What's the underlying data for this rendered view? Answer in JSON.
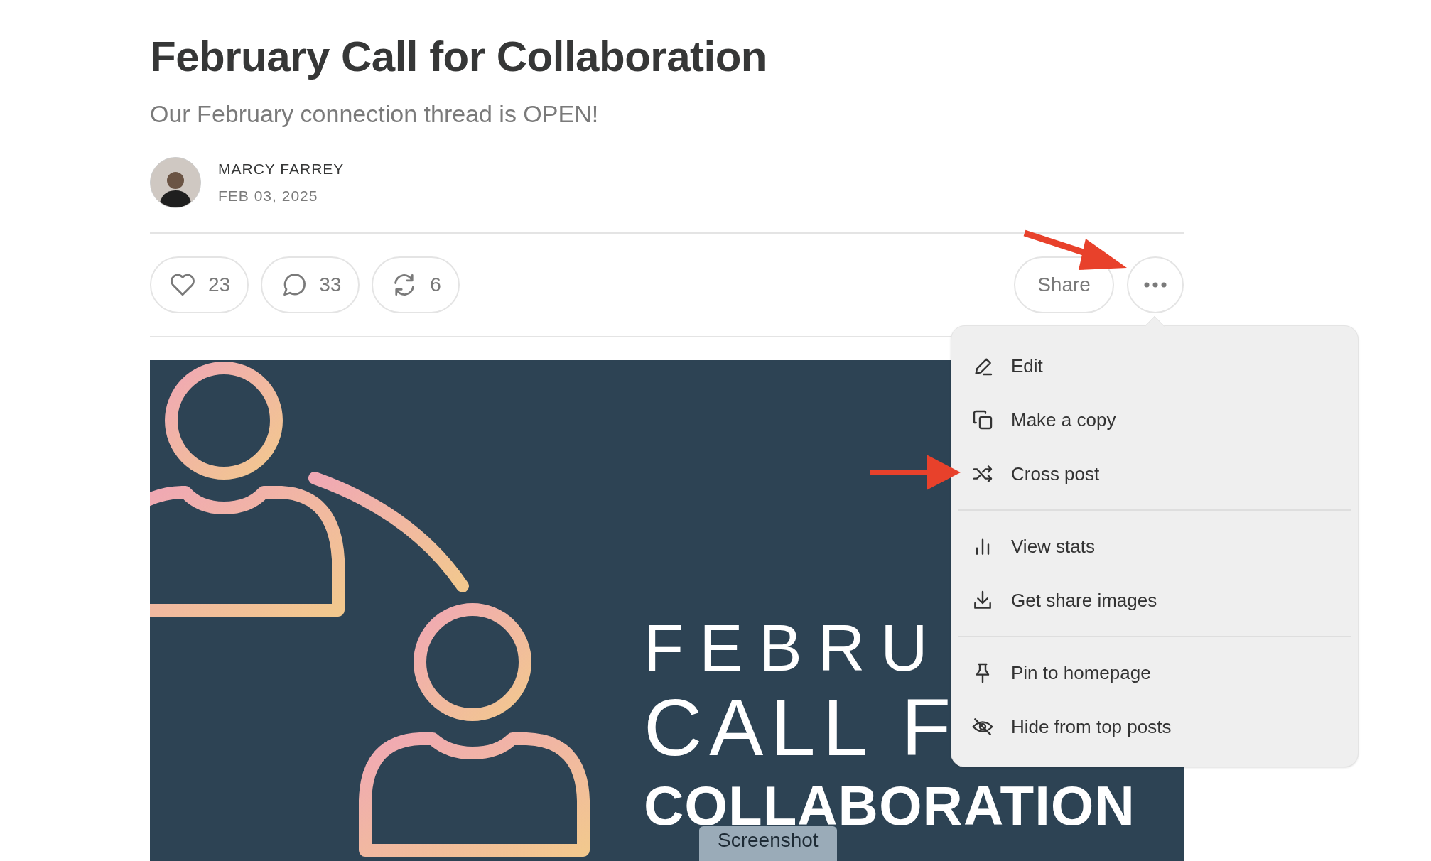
{
  "post": {
    "title": "February Call for Collaboration",
    "subtitle": "Our February connection thread is OPEN!",
    "author": {
      "name": "MARCY FARREY",
      "date": "FEB 03, 2025"
    }
  },
  "actions": [
    {
      "kind": "like",
      "count": "23"
    },
    {
      "kind": "comment",
      "count": "33"
    },
    {
      "kind": "restack",
      "count": "6"
    }
  ],
  "share": "Share",
  "image": {
    "lines": [
      "FEBRU",
      "CALL F",
      "COLLABORATION"
    ],
    "tag": "Screenshot"
  },
  "menu": {
    "groups": [
      [
        {
          "kind": "edit",
          "label": "Edit"
        },
        {
          "kind": "copy",
          "label": "Make a copy"
        },
        {
          "kind": "crosspost",
          "label": "Cross post"
        }
      ],
      [
        {
          "kind": "stats",
          "label": "View stats"
        },
        {
          "kind": "download",
          "label": "Get share images"
        }
      ],
      [
        {
          "kind": "pin",
          "label": "Pin to homepage"
        },
        {
          "kind": "hide",
          "label": "Hide from top posts"
        }
      ]
    ]
  }
}
